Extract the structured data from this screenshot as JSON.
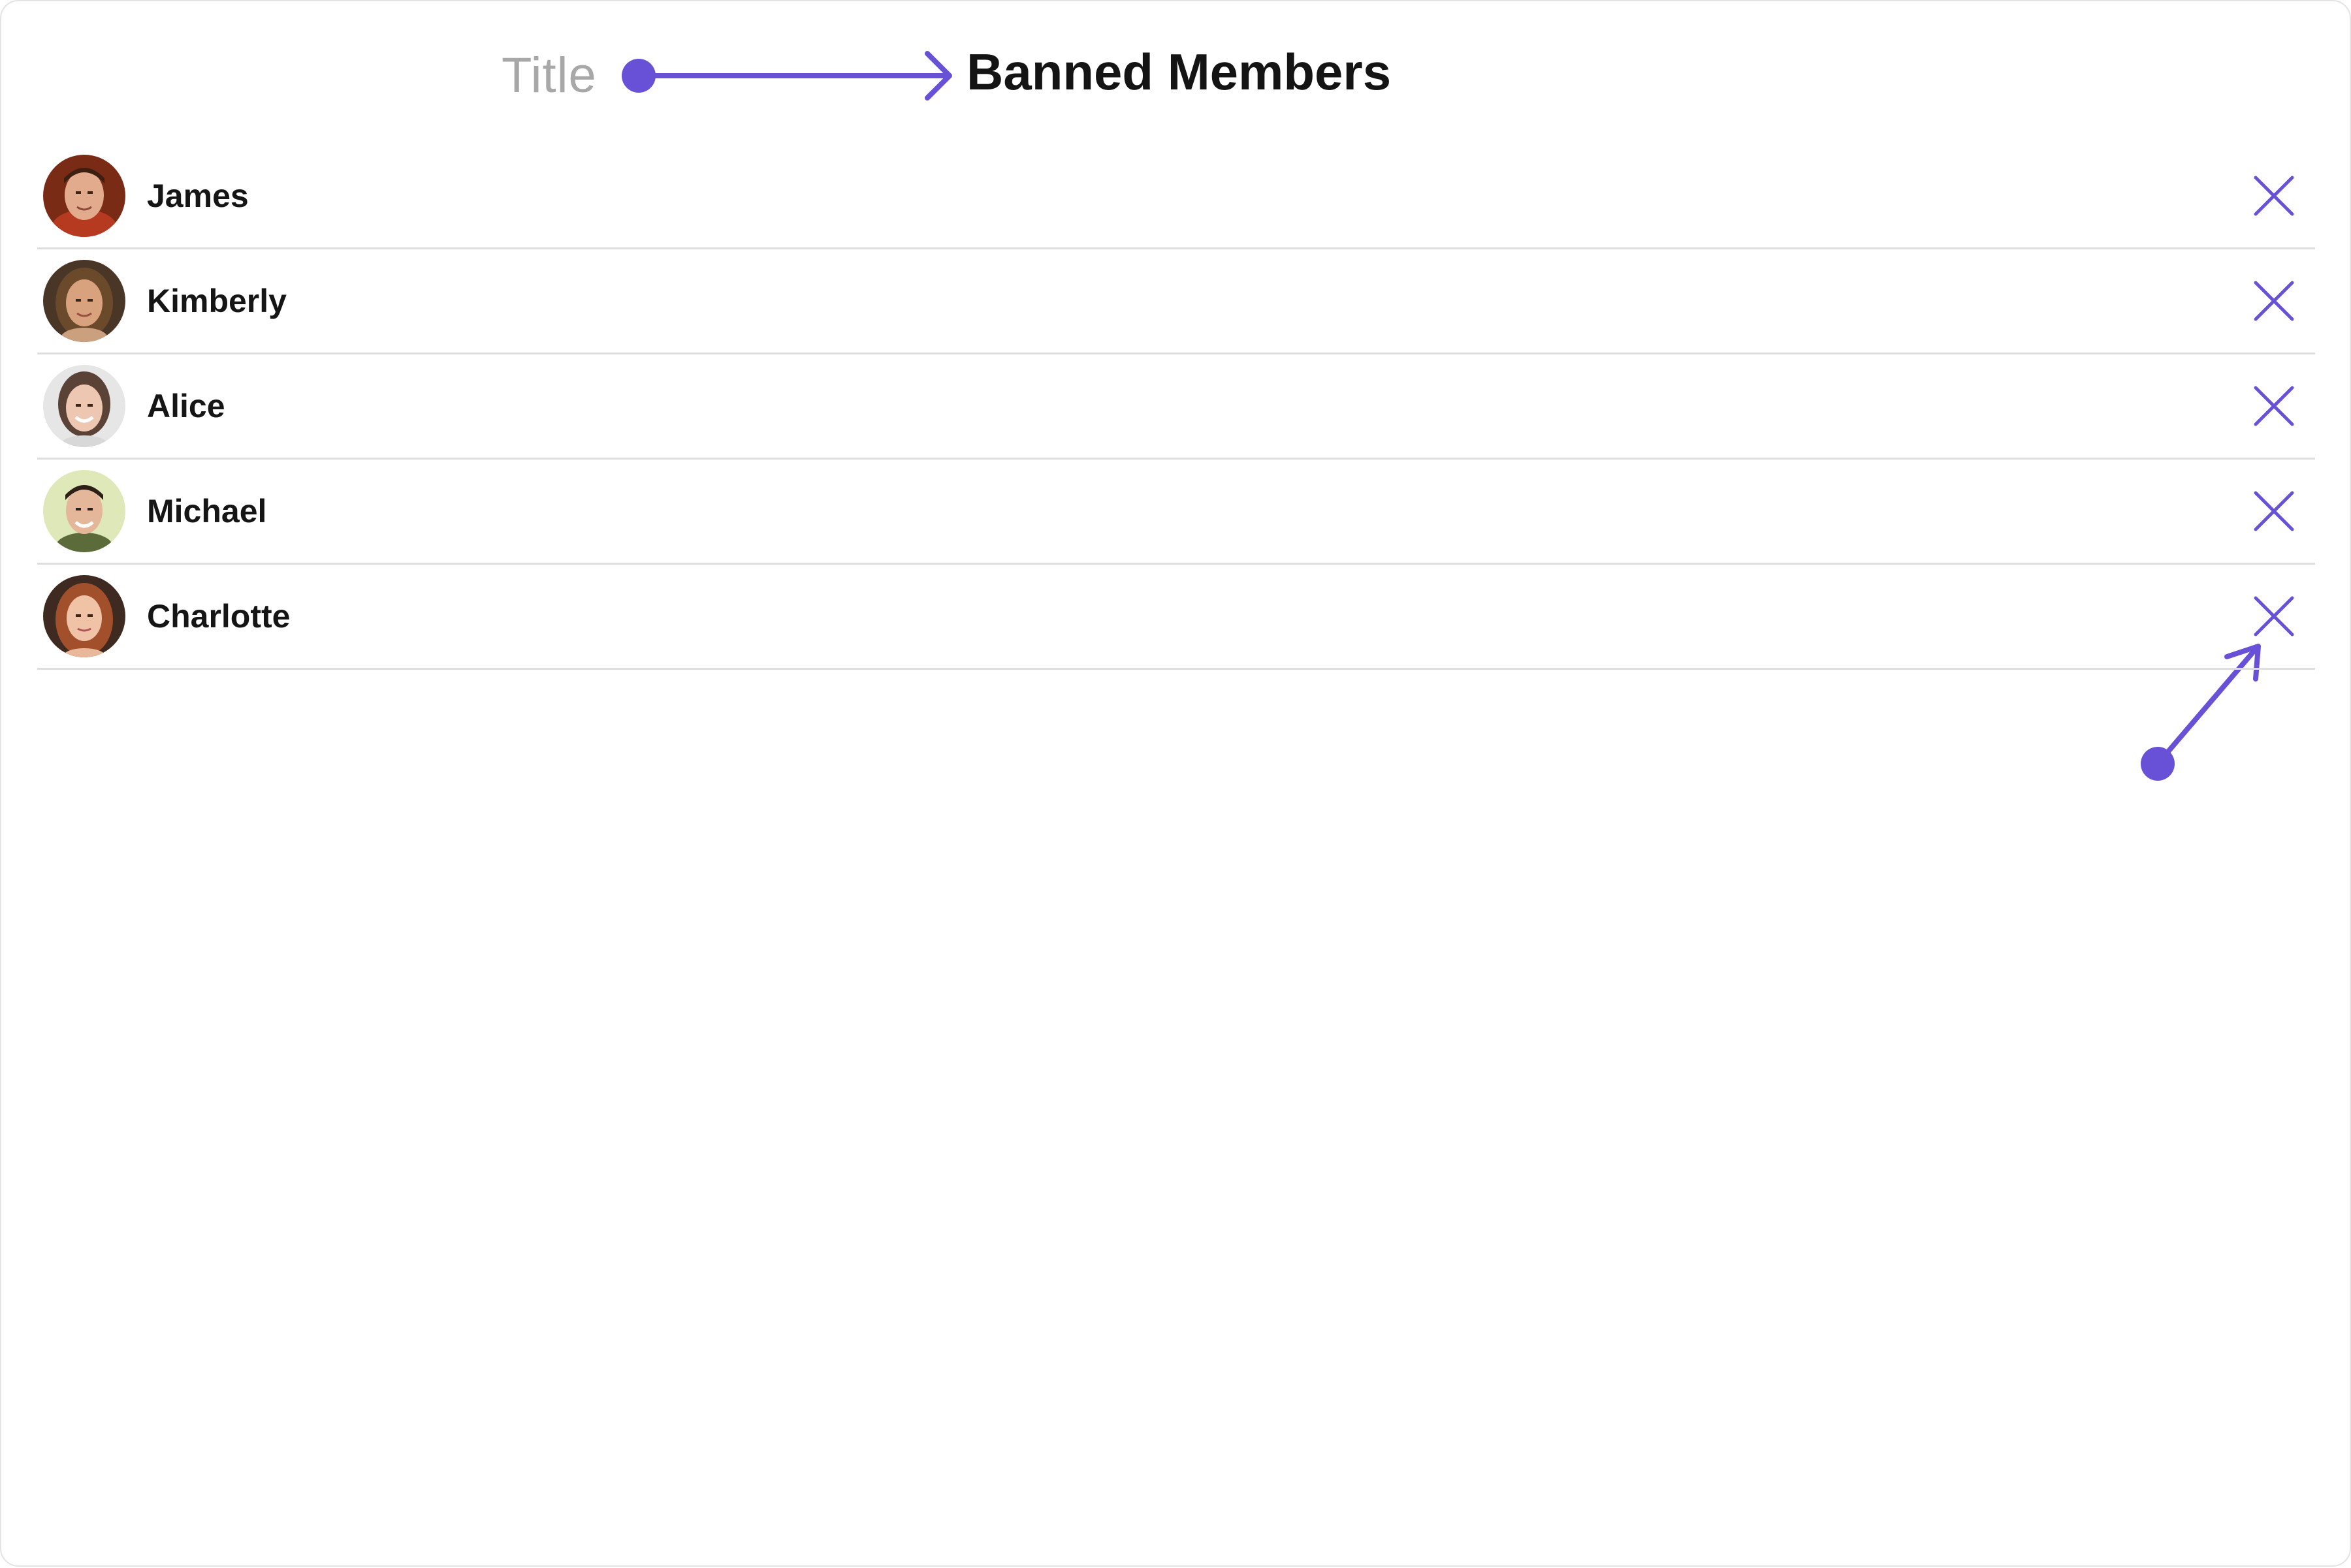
{
  "annotation": {
    "title_label": "Title"
  },
  "header": {
    "title": "Banned Members"
  },
  "members": [
    {
      "name": "James"
    },
    {
      "name": "Kimberly"
    },
    {
      "name": "Alice"
    },
    {
      "name": "Michael"
    },
    {
      "name": "Charlotte"
    }
  ],
  "colors": {
    "accent": "#6851d6",
    "text": "#141414",
    "muted": "#a8a8a8",
    "divider": "#dedede"
  },
  "icons": {
    "unban": "close-icon",
    "annotation_arrow": "arrow-icon"
  }
}
